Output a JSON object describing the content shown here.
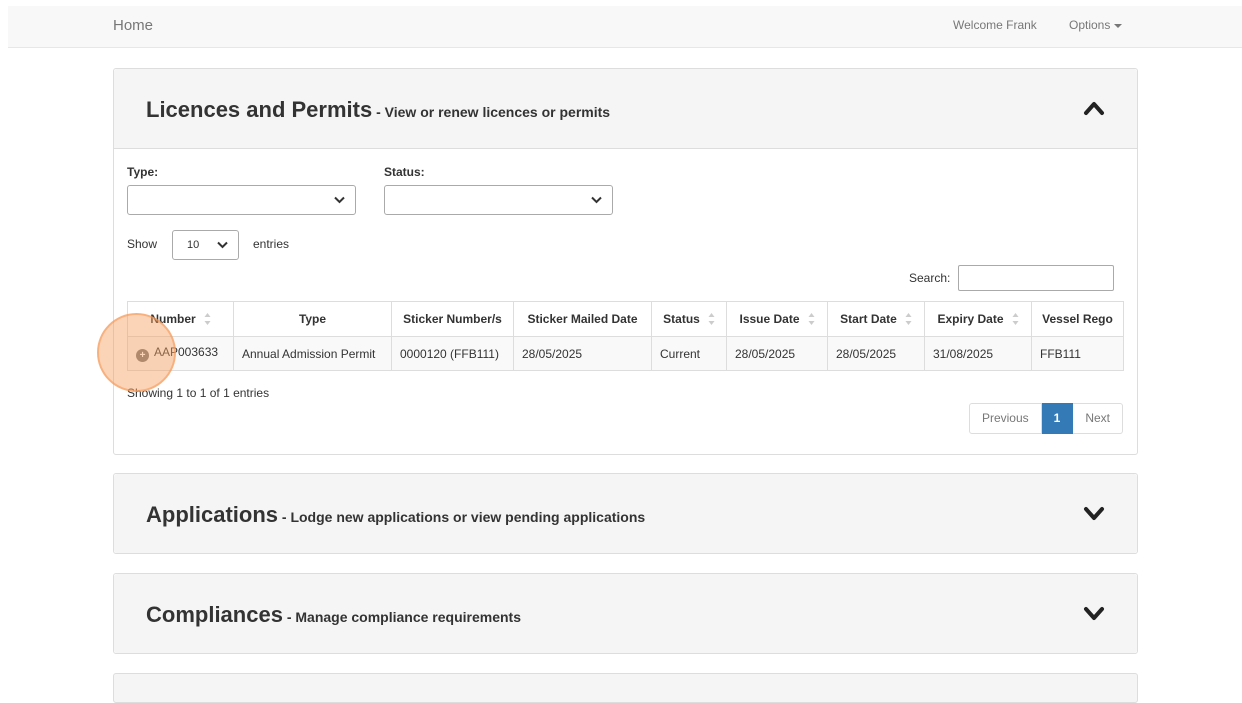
{
  "navbar": {
    "home": "Home",
    "welcome": "Welcome Frank",
    "options": "Options"
  },
  "licences": {
    "title": "Licences and Permits",
    "subtitle": " - View or renew licences or permits",
    "expanded": true,
    "type_label": "Type:",
    "type_value": "",
    "status_label": "Status:",
    "status_value": "",
    "show_label": "Show",
    "page_size": "10",
    "entries_label": "entries",
    "search_label": "Search:",
    "search_value": "",
    "table": {
      "columns": [
        "Number",
        "Type",
        "Sticker Number/s",
        "Sticker Mailed Date",
        "Status",
        "Issue Date",
        "Start Date",
        "Expiry Date",
        "Vessel Rego"
      ],
      "rows": [
        [
          "AAP003633",
          "Annual Admission Permit",
          "0000120 (FFB111)",
          "28/05/2025",
          "Current",
          "28/05/2025",
          "28/05/2025",
          "31/08/2025",
          "FFB111"
        ]
      ]
    },
    "info": "Showing 1 to 1 of 1 entries",
    "pagination": {
      "previous": "Previous",
      "current_page": "1",
      "next": "Next"
    }
  },
  "applications": {
    "title": "Applications",
    "subtitle": " - Lodge new applications or view pending applications",
    "expanded": false
  },
  "compliances": {
    "title": "Compliances",
    "subtitle": " - Manage compliance requirements",
    "expanded": false
  },
  "colors": {
    "accent": "#337ab7",
    "panel_heading_bg": "#f5f5f5",
    "click_highlight": "#f7a05f"
  }
}
